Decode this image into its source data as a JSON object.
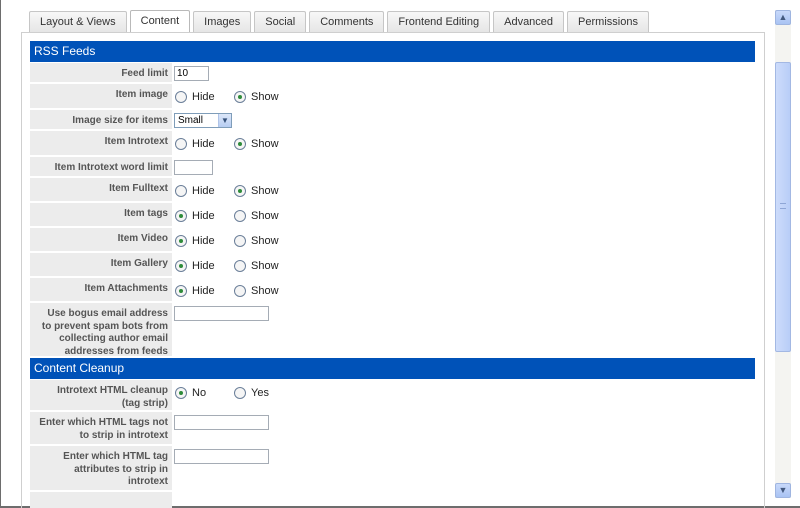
{
  "tabs": [
    {
      "label": "Layout & Views",
      "active": false
    },
    {
      "label": "Content",
      "active": true
    },
    {
      "label": "Images",
      "active": false
    },
    {
      "label": "Social",
      "active": false
    },
    {
      "label": "Comments",
      "active": false
    },
    {
      "label": "Frontend Editing",
      "active": false
    },
    {
      "label": "Advanced",
      "active": false
    },
    {
      "label": "Permissions",
      "active": false
    }
  ],
  "sections": {
    "rss": {
      "title": "RSS Feeds",
      "feed_limit": {
        "label": "Feed limit",
        "value": "10"
      },
      "item_image": {
        "label": "Item image",
        "opt1": "Hide",
        "opt2": "Show",
        "selected": "Show"
      },
      "image_size": {
        "label": "Image size for items",
        "value": "Small"
      },
      "item_introtext": {
        "label": "Item Introtext",
        "opt1": "Hide",
        "opt2": "Show",
        "selected": "Show"
      },
      "introtext_word_limit": {
        "label": "Item Introtext word limit",
        "value": ""
      },
      "item_fulltext": {
        "label": "Item Fulltext",
        "opt1": "Hide",
        "opt2": "Show",
        "selected": "Show"
      },
      "item_tags": {
        "label": "Item tags",
        "opt1": "Hide",
        "opt2": "Show",
        "selected": "Hide"
      },
      "item_video": {
        "label": "Item Video",
        "opt1": "Hide",
        "opt2": "Show",
        "selected": "Hide"
      },
      "item_gallery": {
        "label": "Item Gallery",
        "opt1": "Hide",
        "opt2": "Show",
        "selected": "Hide"
      },
      "item_attachments": {
        "label": "Item Attachments",
        "opt1": "Hide",
        "opt2": "Show",
        "selected": "Hide"
      },
      "bogus_email": {
        "label": "Use bogus email address to prevent spam bots from collecting author email addresses from feeds",
        "value": ""
      }
    },
    "cleanup": {
      "title": "Content Cleanup",
      "html_cleanup": {
        "label": "Introtext HTML cleanup (tag strip)",
        "opt1": "No",
        "opt2": "Yes",
        "selected": "No"
      },
      "tags_not_strip": {
        "label": "Enter which HTML tags not to strip in introtext",
        "value": ""
      },
      "attrs_to_strip": {
        "label": "Enter which HTML tag attributes to strip in introtext",
        "value": ""
      }
    }
  },
  "colors": {
    "section_header": "#0052b8",
    "label_bg": "#ececec",
    "radio_selected": "#2e8b3a"
  },
  "icons": {
    "scroll_up": "chevron-up-icon",
    "scroll_down": "chevron-down-icon",
    "select_arrow": "chevron-down-icon"
  }
}
